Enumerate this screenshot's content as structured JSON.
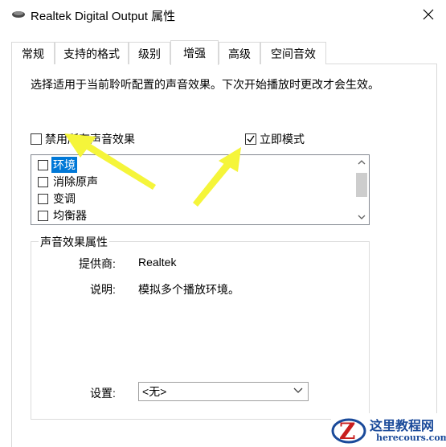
{
  "window": {
    "title": "Realtek Digital Output 属性",
    "icon": "speaker-icon",
    "close_icon": "close-icon"
  },
  "tabs": [
    {
      "label": "常规",
      "active": false
    },
    {
      "label": "支持的格式",
      "active": false
    },
    {
      "label": "级别",
      "active": false
    },
    {
      "label": "增强",
      "active": true
    },
    {
      "label": "高级",
      "active": false
    },
    {
      "label": "空间音效",
      "active": false
    }
  ],
  "description": "选择适用于当前聆听配置的声音效果。下次开始播放时更改才会生效。",
  "disable_all": {
    "label": "禁用所有声音效果",
    "checked": false
  },
  "immediate_mode": {
    "label": "立即模式",
    "checked": true
  },
  "effects": [
    {
      "label": "环境",
      "checked": false,
      "selected": true
    },
    {
      "label": "消除原声",
      "checked": false,
      "selected": false
    },
    {
      "label": "变调",
      "checked": false,
      "selected": false
    },
    {
      "label": "均衡器",
      "checked": false,
      "selected": false
    }
  ],
  "properties": {
    "group_title": "声音效果属性",
    "provider_label": "提供商:",
    "provider_value": "Realtek",
    "description_label": "说明:",
    "description_value": "模拟多个播放环境。",
    "settings_label": "设置:",
    "settings_value": "<无>"
  },
  "watermark": {
    "title": "这里教程网",
    "url": "herecours.com"
  },
  "colors": {
    "selection": "#0078d7",
    "annotation_arrow": "#f5f53a",
    "watermark": "#1a4a9a"
  }
}
